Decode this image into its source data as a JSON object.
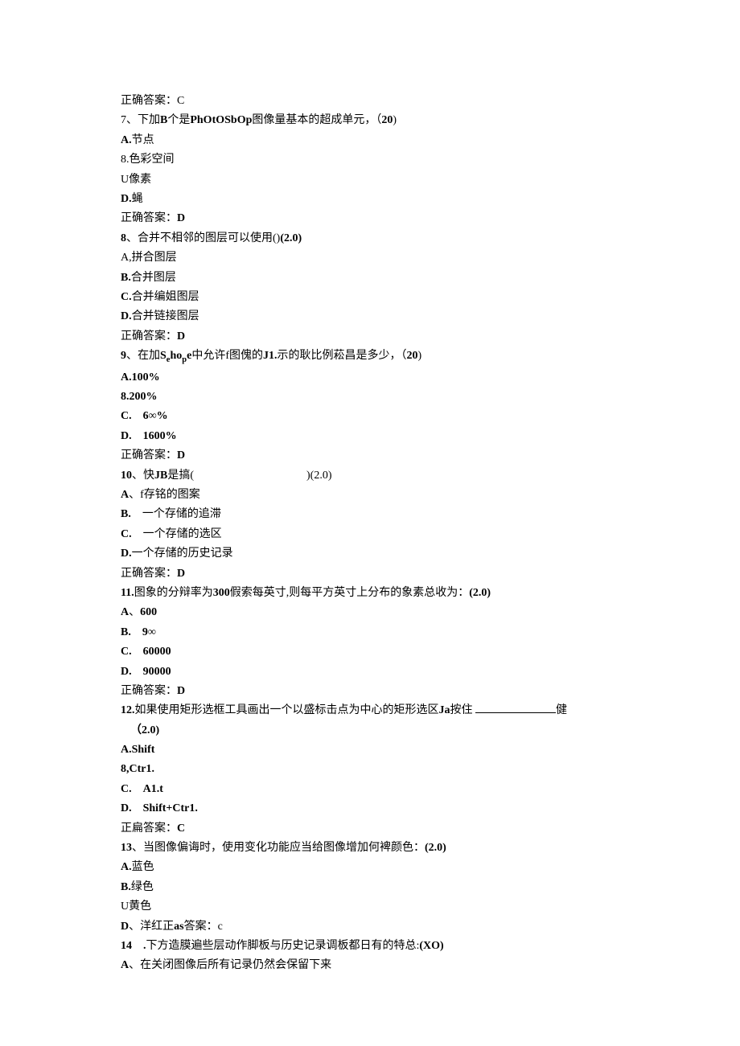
{
  "lines": {
    "pre_answer": "正确答案：C",
    "q7": {
      "stem_prefix": "7、下加",
      "stem_bold1": "B",
      "stem_mid1": "个是",
      "stem_bold2": "PhOtOSbOp",
      "stem_mid2": "图像量基本的超成单元，（",
      "stem_bold3": "20",
      "stem_suffix": ")",
      "a": "A.节点",
      "b": "8.色彩空间",
      "c": "U像素",
      "d": "D.蝇",
      "ans": "正确答案：D"
    },
    "q8": {
      "stem_bold1": "8",
      "stem_text": "、合并不相邻的图层可以使用()",
      "stem_bold2": "(2.0)",
      "a": "A,拼合图层",
      "b": "B.合并图层",
      "c": "C.合并编姐图层",
      "d": "D.合并链接图层",
      "ans": "正确答案：D"
    },
    "q9": {
      "stem_bold1": "9",
      "stem_text1": "、在加",
      "stem_bold2_p1": "S",
      "stem_bold2_sub1": "e",
      "stem_bold2_p2": "ho",
      "stem_bold2_sub2": "p",
      "stem_bold2_p3": "e",
      "stem_text2": "中允许f图傀的",
      "stem_bold3": "J1.",
      "stem_text3": "示的耿比例菘昌是多少，（",
      "stem_bold4": "20",
      "stem_suffix": ")",
      "a": "A.100%",
      "b": "8.200%",
      "c": "C.　6∞%",
      "d": "D.　1600%",
      "ans": "正确答案：D"
    },
    "q10": {
      "stem_bold1": "10",
      "stem_text1": "、快",
      "stem_bold2": "JB",
      "stem_text2": "是搞(　　　　　　　　　　)(2.0)",
      "a": "A、f存铭的图案",
      "b": "B.　一个存储的追滞",
      "c": "C.　一个存储的选区",
      "d": "D.一个存储的历史记录",
      "ans": "正确答案：D"
    },
    "q11": {
      "stem_bold1": "11.",
      "stem_text1": "图象的分辩率为",
      "stem_bold2": "300",
      "stem_text2": "假索每英寸,则每平方英寸上分布的象素总收为：",
      "stem_bold3": "(2.0)",
      "a": "A、600",
      "b": "B.　9∞",
      "c": "C.　60000",
      "d": "D.　90000",
      "ans": "正确答案：D"
    },
    "q12": {
      "stem_bold1": "12.",
      "stem_text1": "如果使用矩形选框工具画出一个以盛标击点为中心的矩形选区",
      "stem_bold2": "Ja",
      "stem_text2": "按住 ",
      "stem_suffix": "健",
      "line2": "（2.0)",
      "a": "A.Shift",
      "b": "8,Ctr1.",
      "c": "C.　A1.t",
      "d": "D.　Shift+Ctr1.",
      "ans": "正扁答案：C"
    },
    "q13": {
      "stem_bold1": "13",
      "stem_text1": "、当图像偏诲时，使用变化功能应当给图像增加何裨颜色：",
      "stem_bold2": "(2.0)",
      "a": "A.蓝色",
      "b": "B.绿色",
      "c": "U黄色",
      "d_prefix": "D",
      "d_text": "、洋红正",
      "d_bold": "as",
      "d_suffix": "答案：c"
    },
    "q14": {
      "stem_bold1": "14　.",
      "stem_text1": "下方造膜遍些层动作脚板与历史记录调板都日有的特总:",
      "stem_bold2": "(XO)",
      "a": "A、在关闭图像后所有记录仍然会保留下来"
    }
  }
}
